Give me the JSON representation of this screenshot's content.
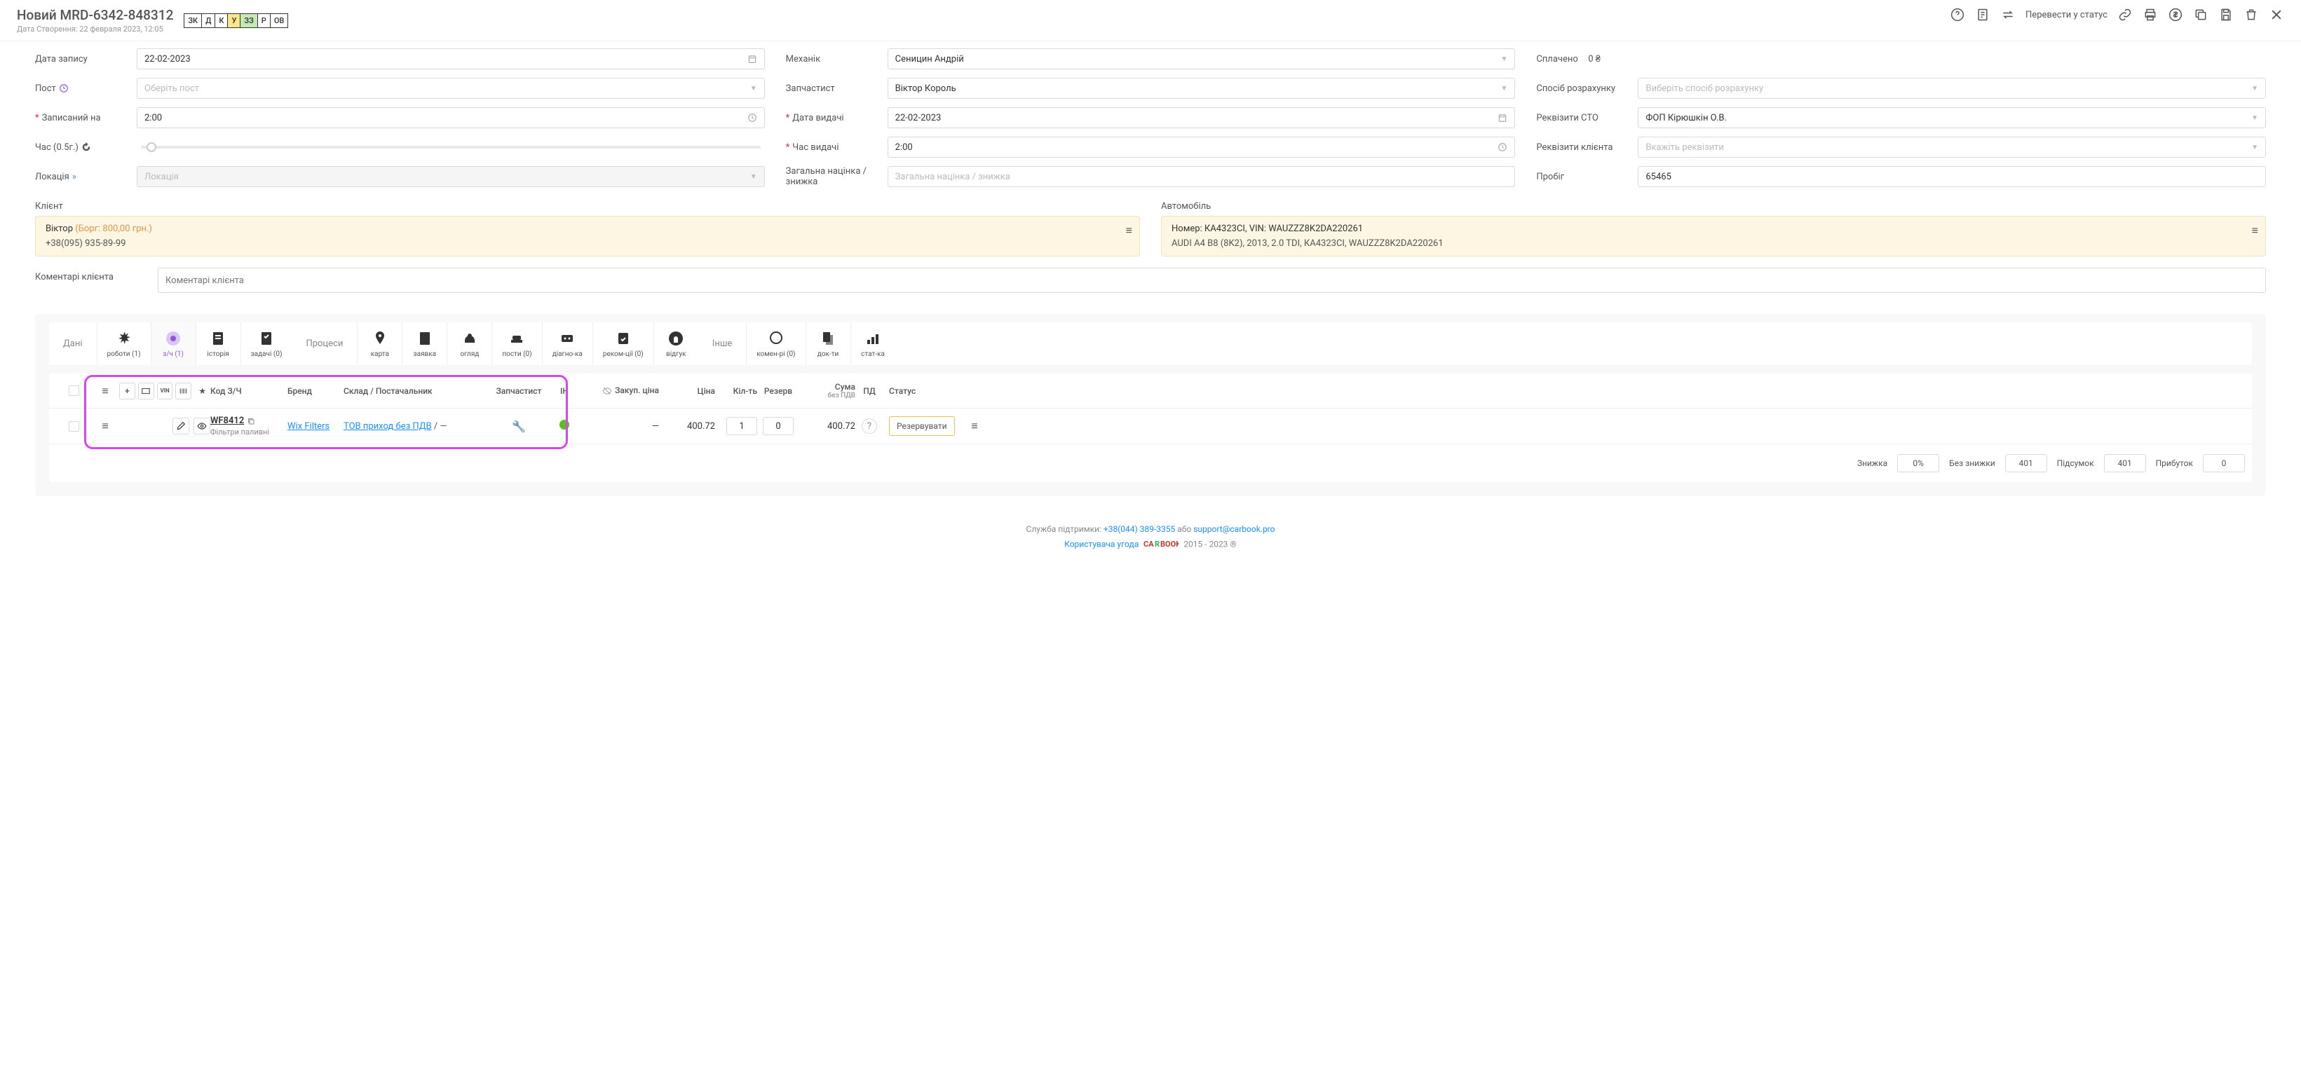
{
  "header": {
    "title": "Новий MRD-6342-848312",
    "subtitle": "Дата Створення: 22 февраля 2023, 12:05",
    "badges": [
      "ЗК",
      "Д",
      "К",
      "У",
      "ЗЗ",
      "Р",
      "ОВ"
    ],
    "transfer": "Перевести у статус"
  },
  "form": {
    "date_label": "Дата запису",
    "date_value": "22-02-2023",
    "post_label": "Пост",
    "post_placeholder": "Оберіть пост",
    "scheduled_label": "Записаний на",
    "scheduled_value": "2:00",
    "time_label": "Час (0.5г.)",
    "location_label": "Локація",
    "location_placeholder": "Локація",
    "mechanic_label": "Механік",
    "mechanic_value": "Сеницин Андрій",
    "partsman_label": "Запчастист",
    "partsman_value": "Віктор Король",
    "issue_date_label": "Дата видачі",
    "issue_date_value": "22-02-2023",
    "issue_time_label": "Час видачі",
    "issue_time_value": "2:00",
    "markup_label": "Загальна націнка / знижка",
    "markup_placeholder": "Загальна націнка / знижка",
    "paid_label": "Сплачено",
    "paid_value": "0 ₴",
    "payment_label": "Спосіб розрахунку",
    "payment_placeholder": "Виберіть спосіб розрахунку",
    "requisites_sto_label": "Реквізити СТО",
    "requisites_sto_value": "ФОП Кірюшкін О.В.",
    "requisites_client_label": "Реквізити клієнта",
    "requisites_client_placeholder": "Вкажіть реквізити",
    "mileage_label": "Пробіг",
    "mileage_value": "65465"
  },
  "client": {
    "section": "Клієнт",
    "name": "Віктор",
    "debt": "(Борг: 800,00 грн.)",
    "phone": "+38(095) 935-89-99"
  },
  "car": {
    "section": "Автомобіль",
    "line1": "Номер: КА4323СІ,  VIN: WAUZZZ8K2DA220261",
    "line2": "AUDI A4 B8 (8K2), 2013, 2.0 TDI, КА4323СІ, WAUZZZ8K2DA220261"
  },
  "comment": {
    "label": "Коментарі клієнта",
    "placeholder": "Коментарі клієнта"
  },
  "tabs": {
    "group1": "Дані",
    "group2": "Процеси",
    "group3": "Інше",
    "works": "роботи (1)",
    "parts": "з/ч (1)",
    "history": "історія",
    "tasks": "задачі (0)",
    "map": "карта",
    "request": "заявка",
    "inspection": "огляд",
    "posts": "пости (0)",
    "diag": "діагно-ка",
    "recom": "реком-ції (0)",
    "feedback": "відгук",
    "comments": "комен-рі (0)",
    "docs": "док-ти",
    "stats": "стат-ка"
  },
  "table": {
    "h_code": "Код З/Ч",
    "h_brand": "Бренд",
    "h_supplier": "Склад / Постачальник",
    "h_spec": "Запчастист",
    "h_ih": "ІН",
    "h_zprice": "Закуп. ціна",
    "h_price": "Ціна",
    "h_qty": "Кіл-ть",
    "h_reserve": "Резерв",
    "h_sum": "Сума",
    "h_sum_sub": "без ПДВ",
    "h_pd": "ПД",
    "h_status": "Статус",
    "row": {
      "code": "WF8412",
      "code_sub": "Фільтри паливні",
      "brand": "Wix Filters",
      "supplier": "ТОВ приход без ПДВ",
      "supplier_suffix": " / —",
      "zprice": "—",
      "price": "400.72",
      "qty": "1",
      "reserve": "0",
      "sum": "400.72",
      "status_btn": "Резервувати"
    },
    "footer": {
      "discount_label": "Знижка",
      "discount_value": "0%",
      "nodisc_label": "Без знижки",
      "nodisc_value": "401",
      "subtotal_label": "Підсумок",
      "subtotal_value": "401",
      "profit_label": "Прибуток",
      "profit_value": "0"
    }
  },
  "footer": {
    "support_pre": "Служба підтримки: ",
    "support_phone": "+38(044) 389-3355",
    "support_mid": " або ",
    "support_email": "support@carbook.pro",
    "agreement": "Користувача угода",
    "years": " 2015 - 2023 ®"
  }
}
